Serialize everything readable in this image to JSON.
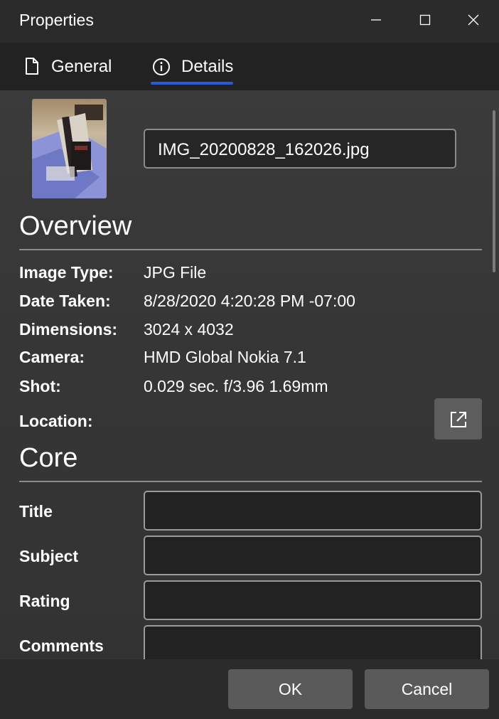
{
  "window": {
    "title": "Properties",
    "minimize_icon": "minimize-icon",
    "maximize_icon": "maximize-icon",
    "close_icon": "close-icon"
  },
  "tabs": [
    {
      "label": "General",
      "icon": "document-icon",
      "selected": false
    },
    {
      "label": "Details",
      "icon": "info-icon",
      "selected": true
    }
  ],
  "accent_color": "#2a5bd7",
  "file": {
    "name": "IMG_20200828_162026.jpg"
  },
  "overview": {
    "title": "Overview",
    "rows": [
      {
        "label": "Image Type:",
        "value": "JPG File"
      },
      {
        "label": "Date Taken:",
        "value": "8/28/2020 4:20:28 PM -07:00"
      },
      {
        "label": "Dimensions:",
        "value": "3024 x 4032"
      },
      {
        "label": "Camera:",
        "value": "HMD Global Nokia 7.1"
      },
      {
        "label": "Shot:",
        "value": "0.029 sec. f/3.96 1.69mm"
      },
      {
        "label": "Location:",
        "value": ""
      }
    ],
    "location_button_icon": "open-external-icon"
  },
  "core": {
    "title": "Core",
    "fields": [
      {
        "label": "Title",
        "value": ""
      },
      {
        "label": "Subject",
        "value": ""
      },
      {
        "label": "Rating",
        "value": ""
      },
      {
        "label": "Comments",
        "value": ""
      }
    ]
  },
  "footer": {
    "ok_label": "OK",
    "cancel_label": "Cancel"
  }
}
